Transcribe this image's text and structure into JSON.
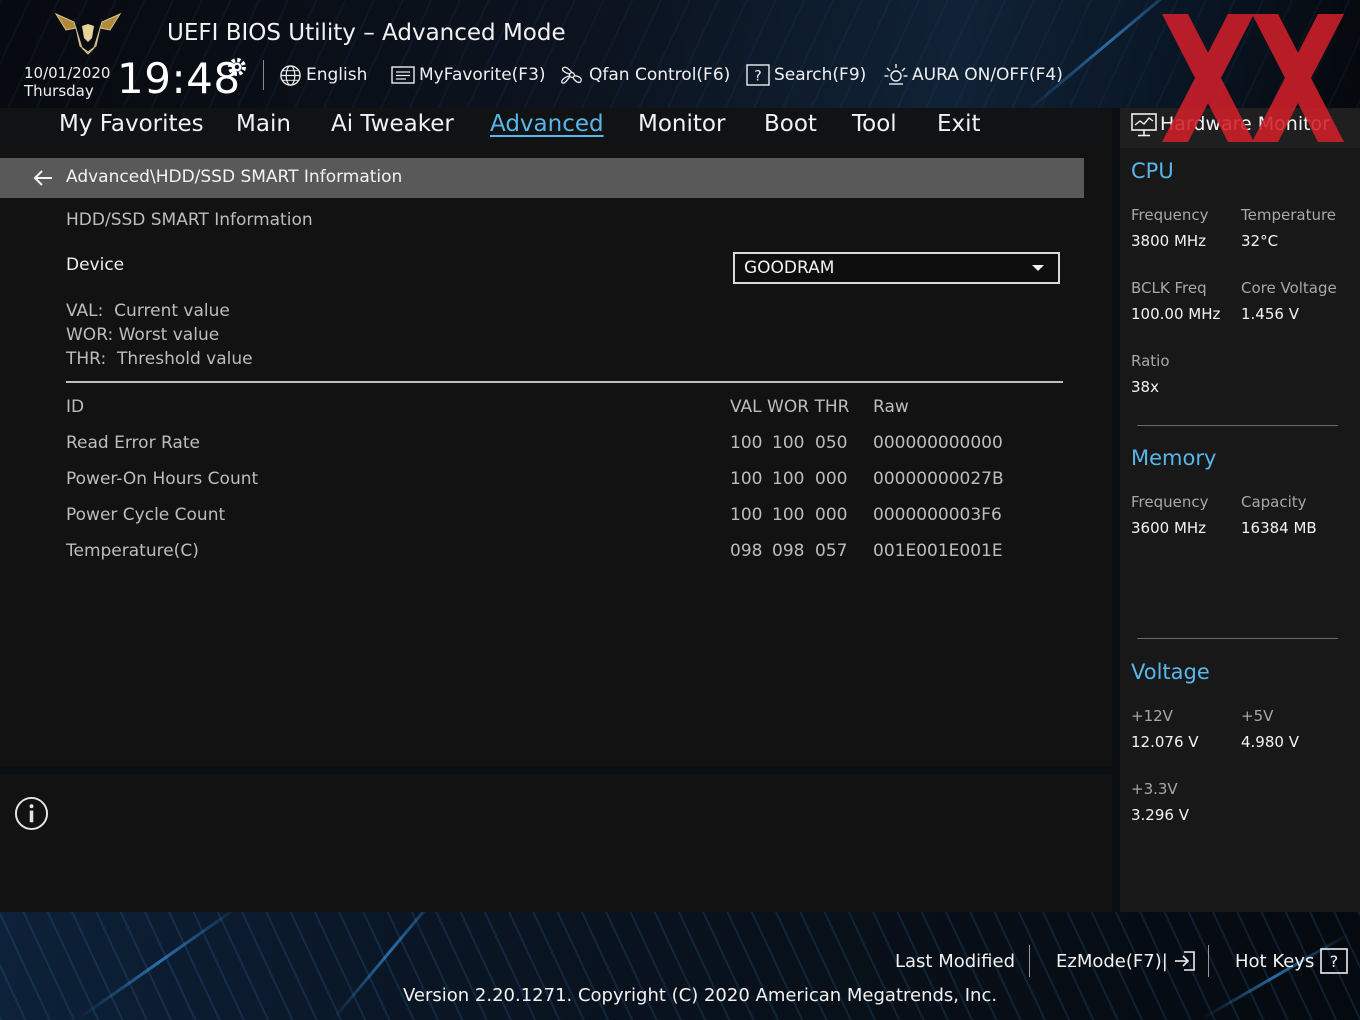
{
  "header": {
    "title": "UEFI BIOS Utility – Advanced Mode",
    "date": "10/01/2020",
    "day": "Thursday",
    "time": "19:48",
    "language": "English",
    "my_favorite": "MyFavorite(F3)",
    "qfan": "Qfan Control(F6)",
    "search": "Search(F9)",
    "aura": "AURA ON/OFF(F4)"
  },
  "tabs": [
    "My Favorites",
    "Main",
    "Ai Tweaker",
    "Advanced",
    "Monitor",
    "Boot",
    "Tool",
    "Exit"
  ],
  "active_tab": "Advanced",
  "main": {
    "breadcrumb": "Advanced\\HDD/SSD SMART Information",
    "section_title": "HDD/SSD SMART Information",
    "device_label": "Device",
    "device_value": "GOODRAM",
    "legend": [
      "VAL:  Current value",
      "WOR: Worst value",
      "THR:  Threshold value"
    ],
    "table_header": {
      "id": "ID",
      "vals": "VAL WOR THR",
      "raw": "Raw"
    },
    "rows": [
      {
        "id": "Read Error Rate",
        "val": "100",
        "wor": "100",
        "thr": "050",
        "raw": "000000000000"
      },
      {
        "id": "Power-On Hours Count",
        "val": "100",
        "wor": "100",
        "thr": "000",
        "raw": "00000000027B"
      },
      {
        "id": "Power Cycle Count",
        "val": "100",
        "wor": "100",
        "thr": "000",
        "raw": "0000000003F6"
      },
      {
        "id": "Temperature(C)",
        "val": "098",
        "wor": "098",
        "thr": "057",
        "raw": "001E001E001E"
      }
    ]
  },
  "hw_monitor": {
    "title": "Hardware Monitor",
    "cpu": {
      "title": "CPU",
      "frequency_label": "Frequency",
      "frequency": "3800 MHz",
      "temperature_label": "Temperature",
      "temperature": "32°C",
      "bclk_label": "BCLK Freq",
      "bclk": "100.00 MHz",
      "core_voltage_label": "Core Voltage",
      "core_voltage": "1.456 V",
      "ratio_label": "Ratio",
      "ratio": "38x"
    },
    "memory": {
      "title": "Memory",
      "frequency_label": "Frequency",
      "frequency": "3600 MHz",
      "capacity_label": "Capacity",
      "capacity": "16384 MB"
    },
    "voltage": {
      "title": "Voltage",
      "v12_label": "+12V",
      "v12": "12.076 V",
      "v5_label": "+5V",
      "v5": "4.980 V",
      "v33_label": "+3.3V",
      "v33": "3.296 V"
    }
  },
  "footer": {
    "last_modified": "Last Modified",
    "ezmode": "EzMode(F7)|",
    "hotkeys": "Hot Keys",
    "version": "Version 2.20.1271. Copyright (C) 2020 American Megatrends, Inc."
  },
  "colors": {
    "accent": "#58b6ea",
    "breadcrumb_bg": "#595959",
    "watermark": "#d01f2a"
  }
}
